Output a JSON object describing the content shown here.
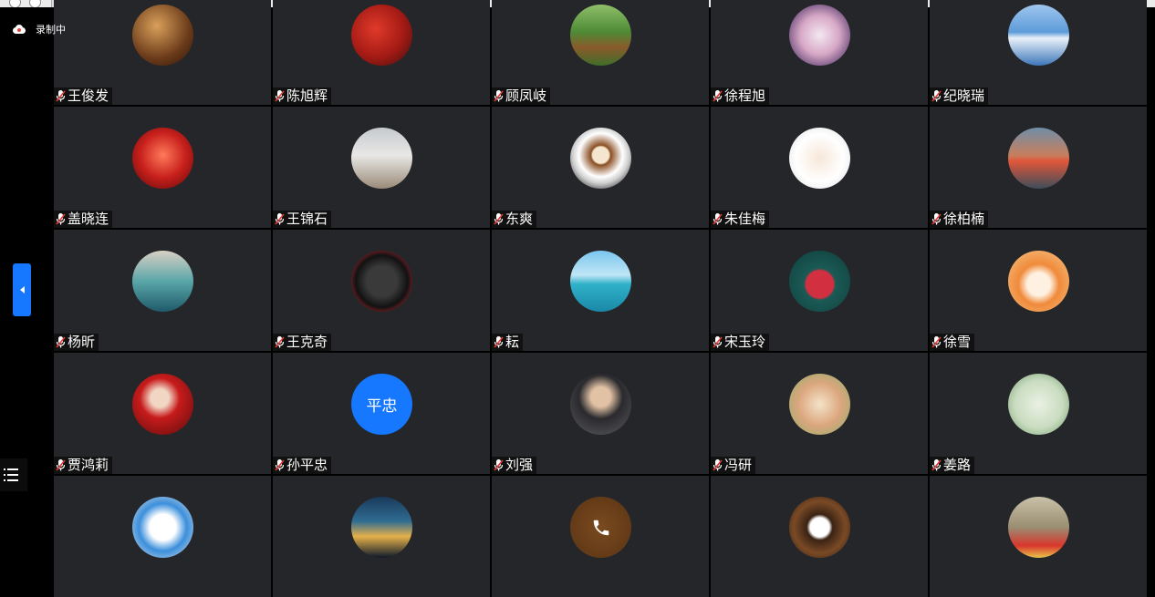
{
  "recording": {
    "label": "录制中",
    "icon": "cloud-record-icon"
  },
  "sidebar": {
    "toggle_icon": "collapse-arrow-icon",
    "list_icon": "participant-list-icon"
  },
  "colors": {
    "tile_bg": "#25262a",
    "accent": "#1677ff",
    "muted_mic": "#e53935"
  },
  "participants": [
    {
      "name": "王俊发",
      "avatar": "chess-photo"
    },
    {
      "name": "陈旭辉",
      "avatar": "flag-photo"
    },
    {
      "name": "顾凤岐",
      "avatar": "horses-photo"
    },
    {
      "name": "徐程旭",
      "avatar": "art-photo"
    },
    {
      "name": "纪晓瑞",
      "avatar": "lake-photo"
    },
    {
      "name": "盖晓连",
      "avatar": "stage-photo"
    },
    {
      "name": "王锦石",
      "avatar": "protective-suit-photo"
    },
    {
      "name": "东爽",
      "avatar": "coffee-photo"
    },
    {
      "name": "朱佳梅",
      "avatar": "cartoon-girl-photo"
    },
    {
      "name": "徐柏楠",
      "avatar": "sunset-photo"
    },
    {
      "name": "杨昕",
      "avatar": "pool-photo"
    },
    {
      "name": "王克奇",
      "avatar": "wang-character-photo"
    },
    {
      "name": "耘",
      "avatar": "sea-island-photo"
    },
    {
      "name": "宋玉玲",
      "avatar": "woman-red-photo"
    },
    {
      "name": "徐雪",
      "avatar": "tiger-cartoon-photo"
    },
    {
      "name": "贾鸿莉",
      "avatar": "red-dress-photo"
    },
    {
      "name": "孙平忠",
      "avatar": "initials",
      "initials": "平忠"
    },
    {
      "name": "刘强",
      "avatar": "man-portrait-photo"
    },
    {
      "name": "冯研",
      "avatar": "family-cartoon-photo"
    },
    {
      "name": "姜路",
      "avatar": "ink-painting-photo"
    },
    {
      "name": "",
      "avatar": "doraemon-photo"
    },
    {
      "name": "",
      "avatar": "city-night-photo"
    },
    {
      "name": "",
      "avatar": "phone-icon-avatar"
    },
    {
      "name": "",
      "avatar": "coffee-beans-photo"
    },
    {
      "name": "",
      "avatar": "child-flag-photo"
    }
  ]
}
